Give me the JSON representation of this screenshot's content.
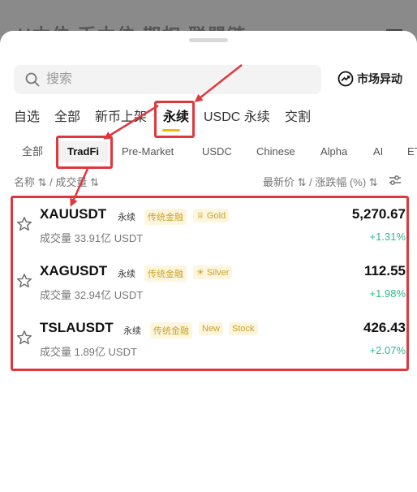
{
  "background": {
    "tabs_text": "U本位 币本位 期权 联盟链"
  },
  "search": {
    "placeholder": "搜索"
  },
  "movers": {
    "label": "市场异动",
    "icon": "trend-up-icon"
  },
  "tabs": [
    "自选",
    "全部",
    "新币上架",
    "永续",
    "USDC 永续",
    "交割"
  ],
  "active_tab": "永续",
  "subtabs": [
    "全部",
    "TradFi",
    "Pre-Market",
    "USDC",
    "Chinese",
    "Alpha",
    "AI",
    "ETF"
  ],
  "active_subtab": "TradFi",
  "columns": {
    "left": "名称 ⇅ / 成交量 ⇅",
    "right": "最新价 ⇅ / 涨跌幅 (%) ⇅"
  },
  "rows": [
    {
      "symbol": "XAUUSDT",
      "type": "永续",
      "tags": [
        "传统金融",
        "Gold"
      ],
      "volume": "成交量 33.91亿 USDT",
      "price": "5,270.67",
      "change": "+1.31%"
    },
    {
      "symbol": "XAGUSDT",
      "type": "永续",
      "tags": [
        "传统金融",
        "Silver"
      ],
      "volume": "成交量 32.94亿 USDT",
      "price": "112.55",
      "change": "+1.98%"
    },
    {
      "symbol": "TSLAUSDT",
      "type": "永续",
      "tags": [
        "传统金融",
        "New",
        "Stock"
      ],
      "volume": "成交量 1.89亿 USDT",
      "price": "426.43",
      "change": "+2.07%"
    }
  ],
  "colors": {
    "accent": "#f0b90b",
    "up": "#2ebd85",
    "highlight": "#e0373d",
    "tag_text": "#c9a227",
    "tag_bg": "#fdf6de"
  }
}
